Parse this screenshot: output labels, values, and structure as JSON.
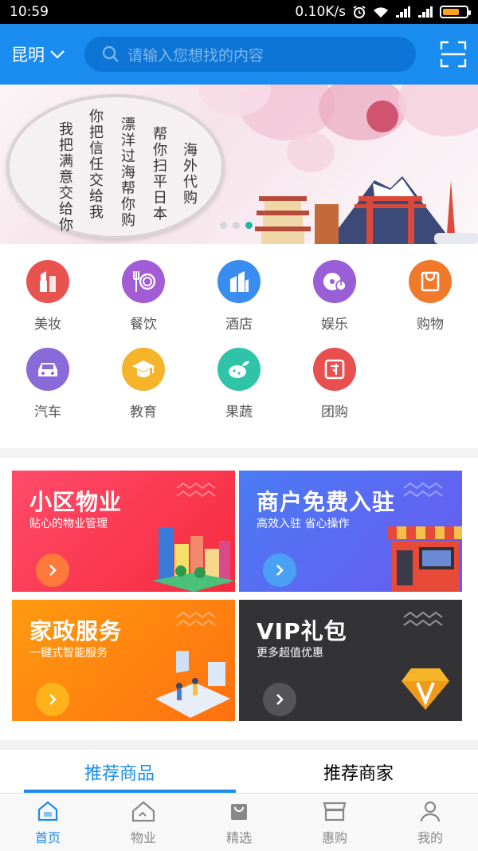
{
  "status_bar": {
    "time": "10:59",
    "speed": "0.10K/s"
  },
  "header": {
    "city": "昆明",
    "search_placeholder": "请输入您想找的内容"
  },
  "banner": {
    "columns": [
      "海外代购",
      "帮你扫平日本",
      "漂洋过海帮你购",
      "你把信任交给我",
      "我把满意交给你"
    ]
  },
  "categories": [
    {
      "label": "美妆",
      "icon": "lipstick-icon",
      "color": "#e8534f"
    },
    {
      "label": "餐饮",
      "icon": "dining-icon",
      "color": "#a35bd6"
    },
    {
      "label": "酒店",
      "icon": "hotel-icon",
      "color": "#3a8df0"
    },
    {
      "label": "娱乐",
      "icon": "music-disc-icon",
      "color": "#9a5fd6"
    },
    {
      "label": "购物",
      "icon": "shopping-bag-icon",
      "color": "#f07a2a"
    },
    {
      "label": "汽车",
      "icon": "car-icon",
      "color": "#8a6ad8"
    },
    {
      "label": "教育",
      "icon": "graduation-cap-icon",
      "color": "#f5b42a"
    },
    {
      "label": "果蔬",
      "icon": "vegetable-icon",
      "color": "#2fc4a8"
    },
    {
      "label": "团购",
      "icon": "group-buy-icon",
      "color": "#e85050"
    }
  ],
  "services": [
    {
      "title": "小区物业",
      "subtitle": "贴心的物业管理"
    },
    {
      "title": "商户免费入驻",
      "subtitle": "高效入驻 省心操作"
    },
    {
      "title": "家政服务",
      "subtitle": "一键式智能服务"
    },
    {
      "title": "VIP礼包",
      "subtitle": "更多超值优惠"
    }
  ],
  "tabs": [
    "推荐商品",
    "推荐商家"
  ],
  "bottom_nav": [
    "首页",
    "物业",
    "精选",
    "惠购",
    "我的"
  ],
  "colors": {
    "primary": "#1a8cf0",
    "accent_teal": "#1ab6a8"
  }
}
